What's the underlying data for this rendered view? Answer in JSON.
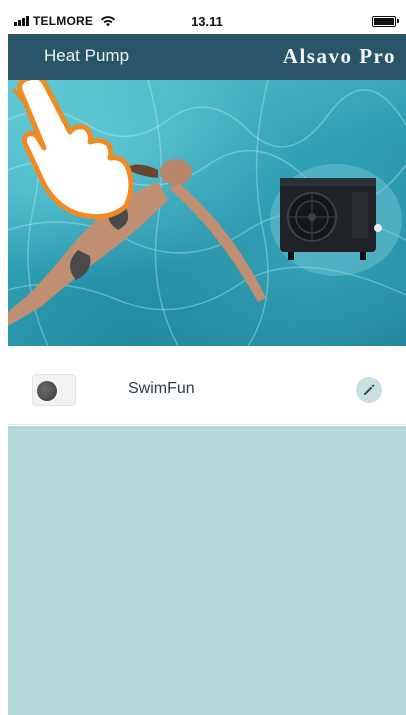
{
  "status_bar": {
    "carrier": "TELMORE",
    "time": "13.11",
    "battery_level": 1.0
  },
  "nav_bar": {
    "back_label": "Heat Pump",
    "brand": "Alsavo Pro"
  },
  "hero": {
    "icon": "heat-pump-icon"
  },
  "device": {
    "name": "SwimFun",
    "edit_icon": "pencil-icon"
  },
  "colors": {
    "nav_background": "#2a5568",
    "panel_background": "#b3d9d9",
    "edit_button_background": "#c9dfe1"
  }
}
